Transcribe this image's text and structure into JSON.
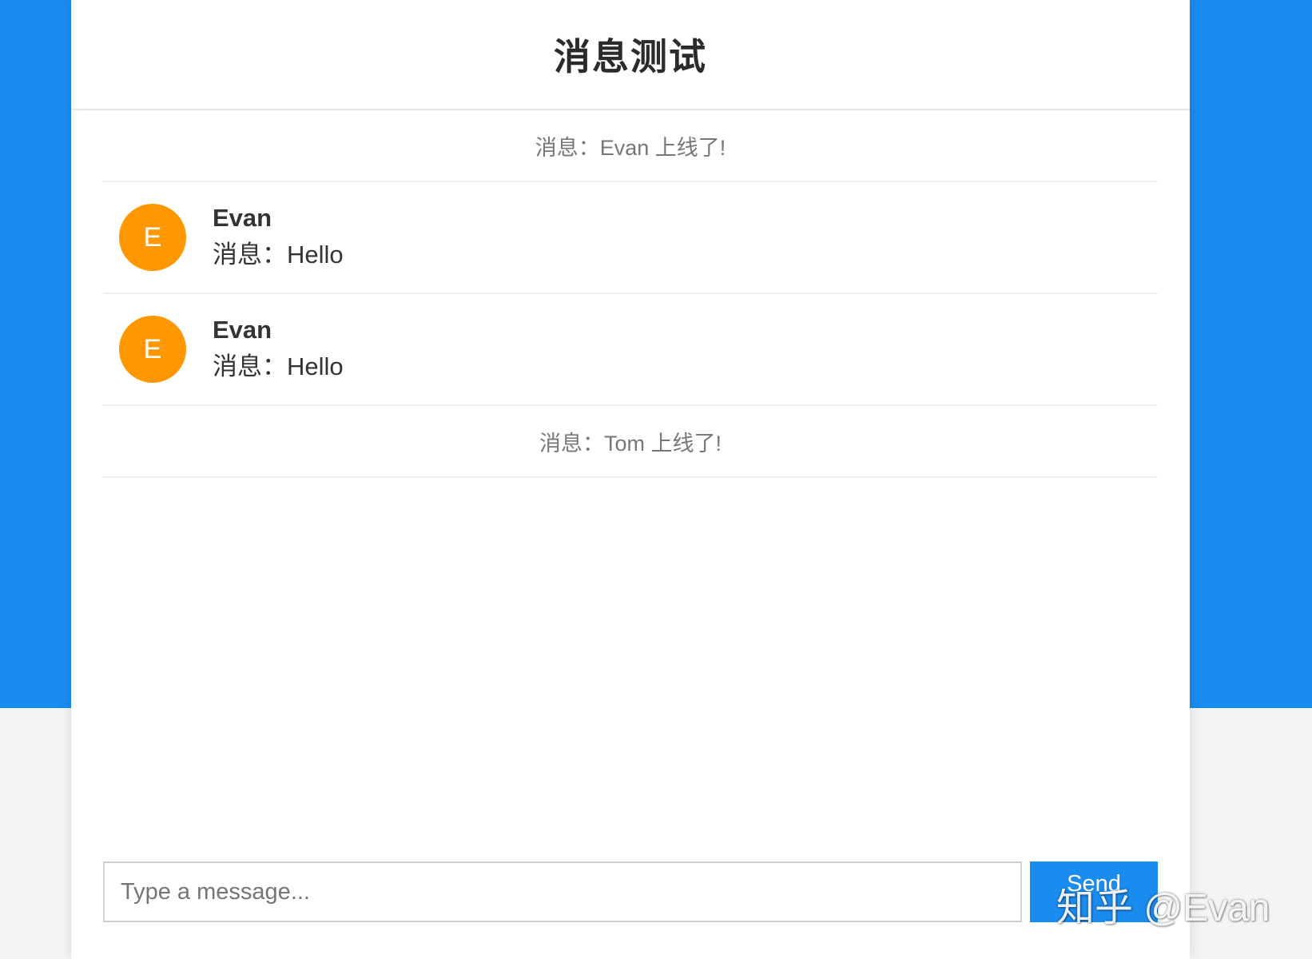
{
  "header": {
    "title": "消息测试"
  },
  "messages": {
    "system_1": "消息：Evan 上线了!",
    "chat_1": {
      "avatar_letter": "E",
      "name": "Evan",
      "text": "消息：Hello"
    },
    "chat_2": {
      "avatar_letter": "E",
      "name": "Evan",
      "text": "消息：Hello"
    },
    "system_2": "消息：Tom 上线了!"
  },
  "composer": {
    "placeholder": "Type a message...",
    "value": "",
    "send_label": "Send"
  },
  "watermark": "知乎 @Evan",
  "colors": {
    "accent": "#1a8cef",
    "avatar": "#ff9800",
    "background_bottom": "#f4f4f4"
  }
}
